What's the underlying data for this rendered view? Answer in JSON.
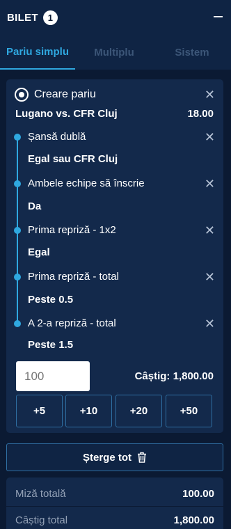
{
  "header": {
    "title": "BILET",
    "count": "1"
  },
  "tabs": [
    {
      "label": "Pariu simplu",
      "active": true
    },
    {
      "label": "Multiplu",
      "active": false
    },
    {
      "label": "Sistem",
      "active": false
    }
  ],
  "bet": {
    "header_label": "Creare pariu",
    "match": "Lugano vs. CFR Cluj",
    "odds": "18.00",
    "legs": [
      {
        "market": "Șansă dublă",
        "selection": "Egal sau CFR Cluj"
      },
      {
        "market": "Ambele echipe să înscrie",
        "selection": "Da"
      },
      {
        "market": "Prima repriză - 1x2",
        "selection": "Egal"
      },
      {
        "market": "Prima repriză - total",
        "selection": "Peste 0.5"
      },
      {
        "market": "A 2-a repriză - total",
        "selection": "Peste 1.5"
      }
    ],
    "stake_placeholder": "100",
    "win_label": "Câștig: 1,800.00",
    "quick_stakes": [
      "+5",
      "+10",
      "+20",
      "+50"
    ]
  },
  "clear_all_label": "Șterge tot",
  "summary": {
    "total_stake_label": "Miză totală",
    "total_stake_value": "100.00",
    "total_win_label": "Câștig total",
    "total_win_value": "1,800.00"
  },
  "colors": {
    "accent": "#2fa8e0",
    "background": "#0b1a33",
    "panel": "#13294b"
  }
}
